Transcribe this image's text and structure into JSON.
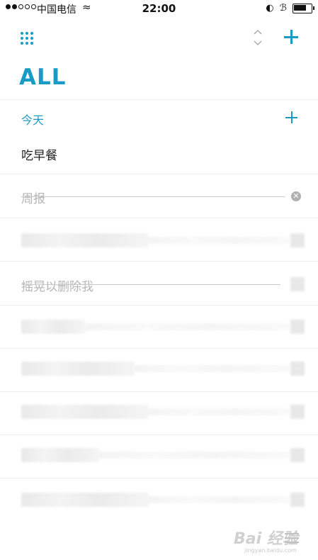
{
  "status_bar": {
    "carrier": "中国电信",
    "time": "22:00",
    "battery_level": 0.7
  },
  "toolbar": {
    "menu_icon": "grid-dots-icon",
    "sort_icon": "sort-updown-icon",
    "add_icon": "plus-icon"
  },
  "list": {
    "title": "ALL"
  },
  "section": {
    "header": "今天",
    "add_icon": "plus-icon"
  },
  "tasks": [
    {
      "label": "吃早餐",
      "completed": false
    },
    {
      "label": "周报",
      "completed": true
    },
    {
      "label": "摇晃以删除我",
      "completed": true
    }
  ],
  "watermark": {
    "text": "Bai 经验",
    "sub": "jingyan.baidu.com"
  },
  "colors": {
    "accent": "#1a9bc5",
    "completed_text": "#b5b5b5",
    "divider": "#ececec"
  }
}
